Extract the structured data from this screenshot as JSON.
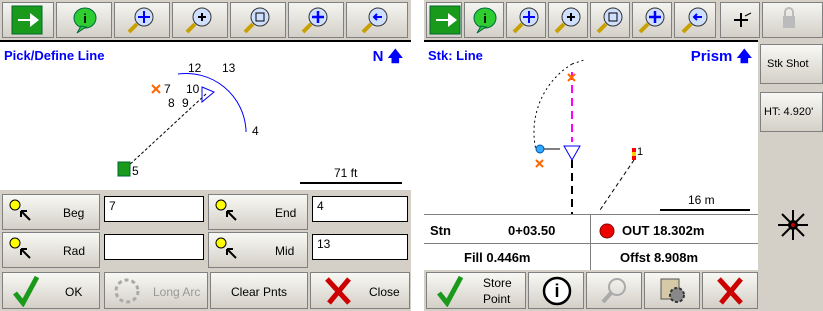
{
  "left": {
    "title": "Pick/Define Line",
    "north": "N",
    "scale": "71 ft",
    "points": [
      "12",
      "13",
      "7",
      "10",
      "8",
      "9",
      "4",
      "5"
    ],
    "fields": {
      "beg": {
        "label": "Beg",
        "value": "7"
      },
      "end": {
        "label": "End",
        "value": "4"
      },
      "rad": {
        "label": "Rad",
        "value": ""
      },
      "mid": {
        "label": "Mid",
        "value": "13"
      }
    },
    "buttons": {
      "ok": "OK",
      "long_arc": "Long Arc",
      "clear_pnts": "Clear Pnts",
      "close": "Close"
    }
  },
  "right": {
    "title": "Stk: Line",
    "prism": "Prism",
    "scale": "16 m",
    "point_label": "1",
    "stn_label": "Stn",
    "stn_value": "0+03.50",
    "out_value": "OUT 18.302m",
    "fill_value": "Fill 0.446m",
    "offst_value": "Offst 8.908m",
    "store_point": [
      "Store",
      "Point"
    ],
    "side": {
      "stk_shot": "Stk Shot",
      "ht": "HT: 4.920'"
    }
  },
  "colors": {
    "toolbar": "#d4d0c8",
    "green_arrow": "#1a9a1a",
    "blue": "#0000ff",
    "red": "#cc0000",
    "magenta": "#ff00ff"
  }
}
